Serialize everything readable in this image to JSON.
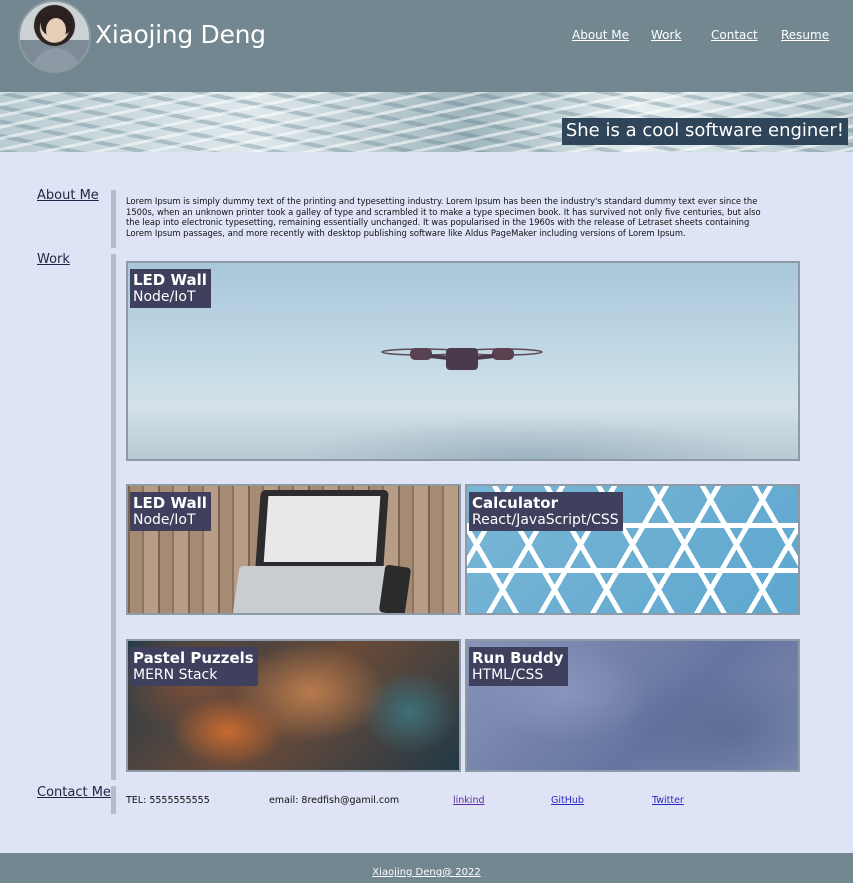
{
  "header": {
    "name": "Xiaojing Deng",
    "nav": [
      "About Me",
      "Work",
      "Contact",
      "Resume"
    ]
  },
  "hero": {
    "tagline": "She is a cool software enginer!"
  },
  "sections": {
    "about": "About Me",
    "work": "Work",
    "contact": "Contact Me"
  },
  "about": {
    "text": "Lorem Ipsum is simply dummy text of the printing and typesetting industry. Lorem Ipsum has been the industry's standard dummy text ever since the 1500s, when an unknown printer took a galley of type and scrambled it to make a type specimen book. It has survived not only five centuries, but also the leap into electronic typesetting, remaining essentially unchanged. It was popularised in the 1960s with the release of Letraset sheets containing Lorem Ipsum passages, and more recently with desktop publishing software like Aldus PageMaker including versions of Lorem Ipsum."
  },
  "work": {
    "projects": [
      {
        "title": "LED Wall",
        "stack": "Node/IoT"
      },
      {
        "title": "LED Wall",
        "stack": "Node/IoT"
      },
      {
        "title": "Calculator",
        "stack": "React/JavaScript/CSS"
      },
      {
        "title": "Pastel Puzzels",
        "stack": "MERN Stack"
      },
      {
        "title": "Run Buddy",
        "stack": "HTML/CSS"
      }
    ]
  },
  "contact": {
    "tel": "TEL: 5555555555",
    "email": "email: 8redfish@gamil.com",
    "links": [
      "linkind",
      "GitHub",
      "Twitter"
    ]
  },
  "footer": {
    "text": "Xiaojing Deng@ 2022"
  }
}
